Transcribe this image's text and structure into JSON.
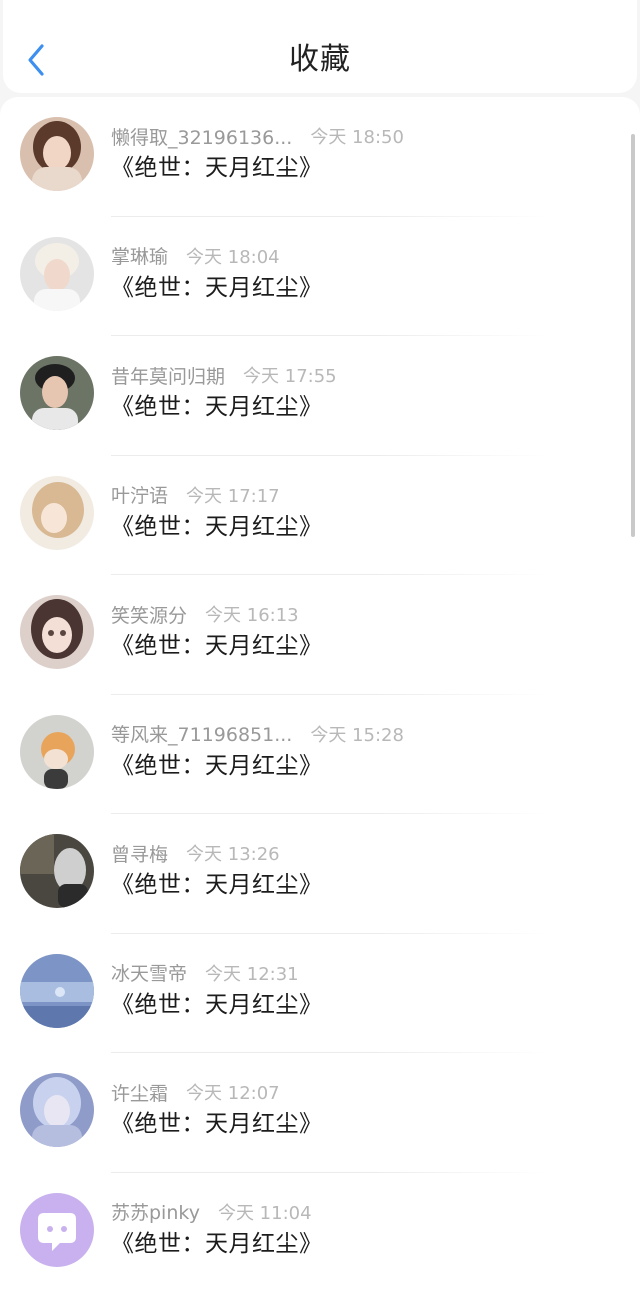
{
  "header": {
    "title": "收藏",
    "back_icon": "chevron-left-icon",
    "accent_color": "#3d8ff0"
  },
  "items": [
    {
      "name": "懒得取_32196136...",
      "time": "今天 18:50",
      "title": "《绝世：天月红尘》",
      "avatar_color": "#d7b9a8"
    },
    {
      "name": "掌琳瑜",
      "time": "今天 18:04",
      "title": "《绝世：天月红尘》",
      "avatar_color": "#dcdcdc"
    },
    {
      "name": "昔年莫问归期",
      "time": "今天 17:55",
      "title": "《绝世：天月红尘》",
      "avatar_color": "#5a5f55"
    },
    {
      "name": "叶泞语",
      "time": "今天 17:17",
      "title": "《绝世：天月红尘》",
      "avatar_color": "#efe6da"
    },
    {
      "name": "笑笑源分",
      "time": "今天 16:13",
      "title": "《绝世：天月红尘》",
      "avatar_color": "#d9c8c2"
    },
    {
      "name": "等风来_71196851...",
      "time": "今天 15:28",
      "title": "《绝世：天月红尘》",
      "avatar_color": "#cfcfcb"
    },
    {
      "name": "曾寻梅",
      "time": "今天 13:26",
      "title": "《绝世：天月红尘》",
      "avatar_color": "#4b4842"
    },
    {
      "name": "冰天雪帝",
      "time": "今天 12:31",
      "title": "《绝世：天月红尘》",
      "avatar_color": "#7c93c4"
    },
    {
      "name": "许尘霜",
      "time": "今天 12:07",
      "title": "《绝世：天月红尘》",
      "avatar_color": "#8f9bc8"
    },
    {
      "name": "苏苏pinky",
      "time": "今天 11:04",
      "title": "《绝世：天月红尘》",
      "avatar_color": "#c8b1ee"
    }
  ]
}
